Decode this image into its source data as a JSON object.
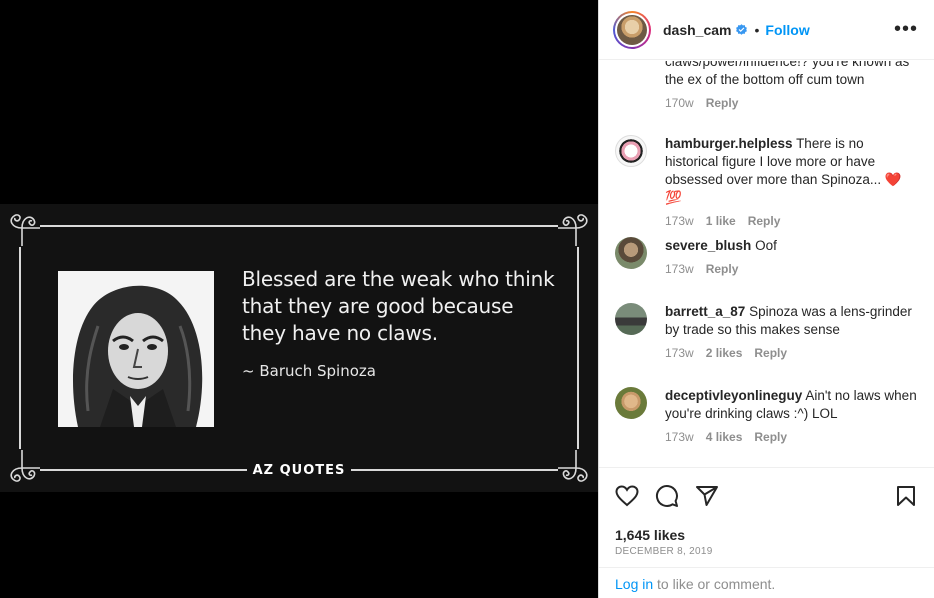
{
  "post": {
    "quote": "Blessed are the weak who think that they are good because they have no claws.",
    "author": "~ Baruch Spinoza",
    "brand": "AZ QUOTES"
  },
  "header": {
    "username": "dash_cam",
    "separator": "•",
    "follow_label": "Follow",
    "more_label": "•••"
  },
  "comments": [
    {
      "user": "",
      "text": "claws/power/influence!? you're known as the ex of the bottom off cum town",
      "time": "170w",
      "likes": "",
      "reply": "Reply"
    },
    {
      "user": "hamburger.helpless",
      "text": "There is no historical figure I love more or have obsessed over more than Spinoza... ❤️ 💯",
      "time": "173w",
      "likes": "1 like",
      "reply": "Reply"
    },
    {
      "user": "severe_blush",
      "text": "Oof",
      "time": "173w",
      "likes": "",
      "reply": "Reply"
    },
    {
      "user": "barrett_a_87",
      "text": "Spinoza was a lens-grinder by trade so this makes sense",
      "time": "173w",
      "likes": "2 likes",
      "reply": "Reply"
    },
    {
      "user": "deceptivleyonlineguy",
      "text": "Ain't no laws when you're drinking claws :^) LOL",
      "time": "173w",
      "likes": "4 likes",
      "reply": "Reply"
    }
  ],
  "stats": {
    "likes": "1,645 likes",
    "date": "DECEMBER 8, 2019"
  },
  "login": {
    "link": "Log in",
    "rest": " to like or comment."
  },
  "colors": {
    "accent": "#0095f6",
    "verified": "#3897f0",
    "muted": "#8e8e8e"
  },
  "icons": [
    "verified-badge-icon",
    "heart-icon",
    "comment-icon",
    "share-icon",
    "bookmark-icon"
  ]
}
